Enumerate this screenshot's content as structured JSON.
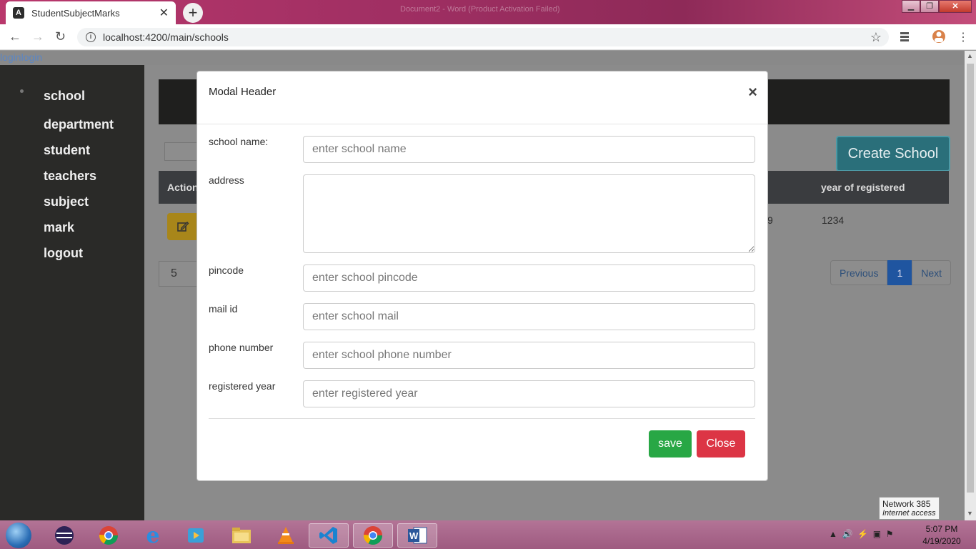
{
  "browser": {
    "tab_title": "StudentSubjectMarks",
    "tab_close": "✕",
    "new_tab": "+",
    "background_title": "Document2 - Word (Product Activation Failed)",
    "url": "localhost:4200/main/schools",
    "window_buttons": [
      "▁",
      "❐",
      "✕"
    ]
  },
  "page": {
    "login_link": "loginlogin"
  },
  "sidebar": {
    "items": [
      {
        "label": "school"
      },
      {
        "label": "department"
      },
      {
        "label": "student"
      },
      {
        "label": "teachers"
      },
      {
        "label": "subject"
      },
      {
        "label": "mark"
      },
      {
        "label": "logout"
      }
    ]
  },
  "main": {
    "create_button": "Create School",
    "table": {
      "headers": [
        "Action",
        "year of registered"
      ],
      "row": {
        "partial_value": "9",
        "year": "1234"
      }
    },
    "page_size": "5",
    "pagination": {
      "previous": "Previous",
      "current": "1",
      "next": "Next"
    }
  },
  "modal": {
    "title": "Modal Header",
    "close_icon": "×",
    "fields": [
      {
        "label": "school name:",
        "placeholder": "enter school name",
        "value": ""
      },
      {
        "label": "address",
        "placeholder": "",
        "value": ""
      },
      {
        "label": "pincode",
        "placeholder": "enter school pincode",
        "value": ""
      },
      {
        "label": "mail id",
        "placeholder": "enter school mail",
        "value": ""
      },
      {
        "label": "phone number",
        "placeholder": "enter school phone number",
        "value": ""
      },
      {
        "label": "registered year",
        "placeholder": "enter registered year",
        "value": ""
      }
    ],
    "save_label": "save",
    "close_label": "Close"
  },
  "taskbar": {
    "time": "5:07 PM",
    "date": "4/19/2020",
    "tooltip_title": "Network  385",
    "tooltip_sub": "Internet access"
  },
  "colors": {
    "save": "#28a745",
    "close": "#dc3545",
    "create": "#17a2b8",
    "edit": "#ffc107"
  }
}
